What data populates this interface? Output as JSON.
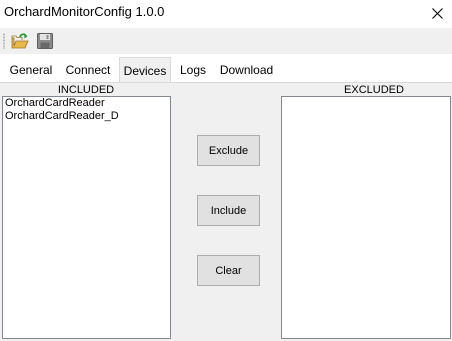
{
  "window": {
    "title": "OrchardMonitorConfig 1.0.0",
    "close_icon": "close-icon"
  },
  "toolbar": {
    "icons": [
      "open-folder-icon",
      "save-disk-icon"
    ],
    "colors": {
      "folder": "#e8b84a",
      "arrow": "#2e9e3a",
      "disk": "#7a7a7a"
    }
  },
  "tabs": [
    {
      "label": "General",
      "active": false
    },
    {
      "label": "Connect",
      "active": false
    },
    {
      "label": "Devices",
      "active": true
    },
    {
      "label": "Logs",
      "active": false
    },
    {
      "label": "Download",
      "active": false
    }
  ],
  "devices": {
    "included": {
      "label": "INCLUDED",
      "items": [
        "OrchardCardReader",
        "OrchardCardReader_D"
      ]
    },
    "excluded": {
      "label": "EXCLUDED",
      "items": []
    },
    "buttons": {
      "exclude": "Exclude",
      "include": "Include",
      "clear": "Clear"
    }
  }
}
